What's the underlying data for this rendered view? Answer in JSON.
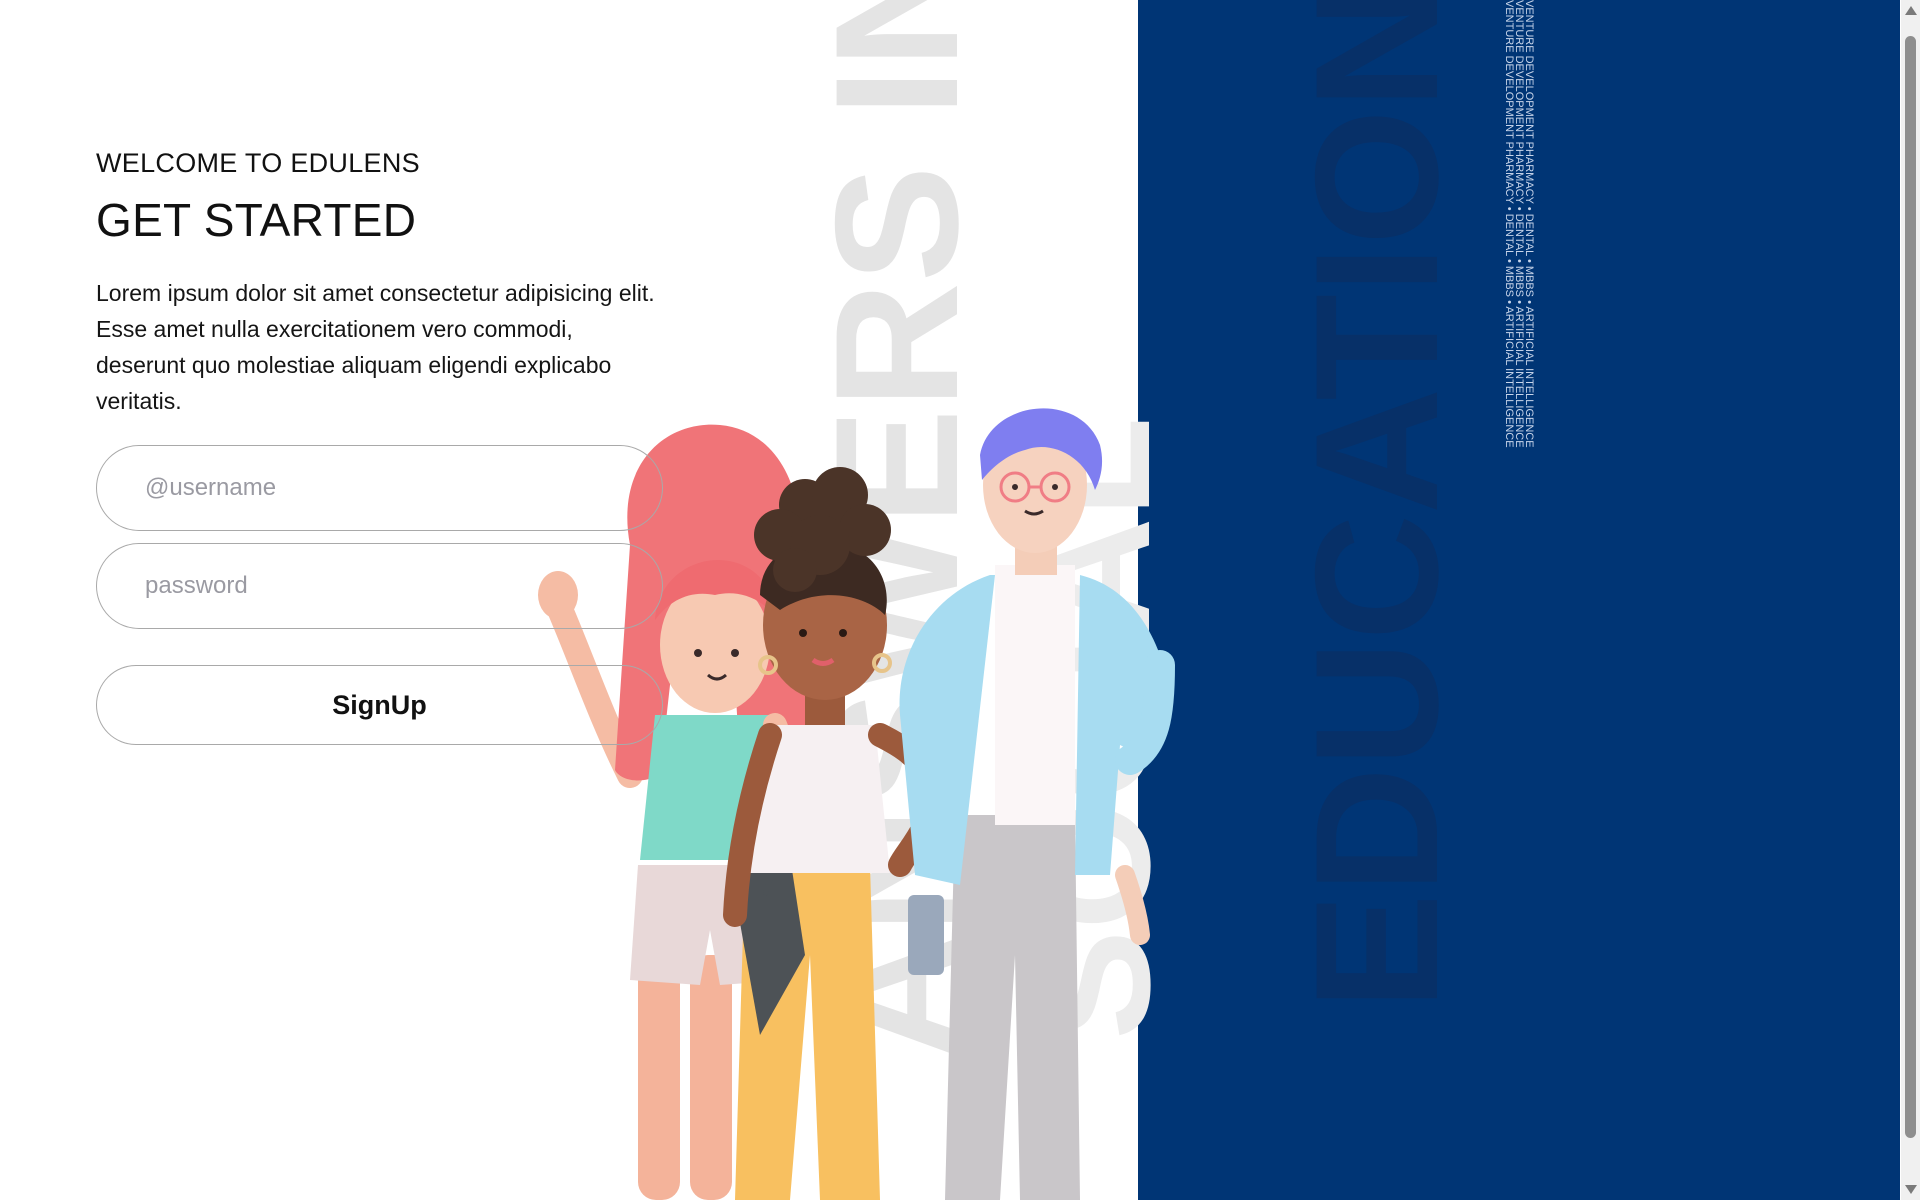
{
  "background": {
    "word_gray_1": "ANSWERS IN",
    "word_gray_2": "SOCIAL",
    "word_blue": "EDUCATION",
    "ticker_text": "VENTURE DEVELOPMENT PHARMACY • DENTAL • MBBS • ARTIFICIAL INTELLIGENCE"
  },
  "form": {
    "welcome": "WELCOME TO EDULENS",
    "title": "GET STARTED",
    "description": "Lorem ipsum dolor sit amet consectetur adipisicing elit. Esse amet nulla exercitationem vero commodi, deserunt quo molestiae aliquam eligendi explicabo veritatis.",
    "username_placeholder": "@username",
    "password_placeholder": "password",
    "signup_label": "SignUp"
  },
  "colors": {
    "panel_blue": "#003575",
    "text_dark": "#111111",
    "border_gray": "#a9a9a9"
  },
  "illustration": {
    "subject": "three cartoon students standing together"
  }
}
